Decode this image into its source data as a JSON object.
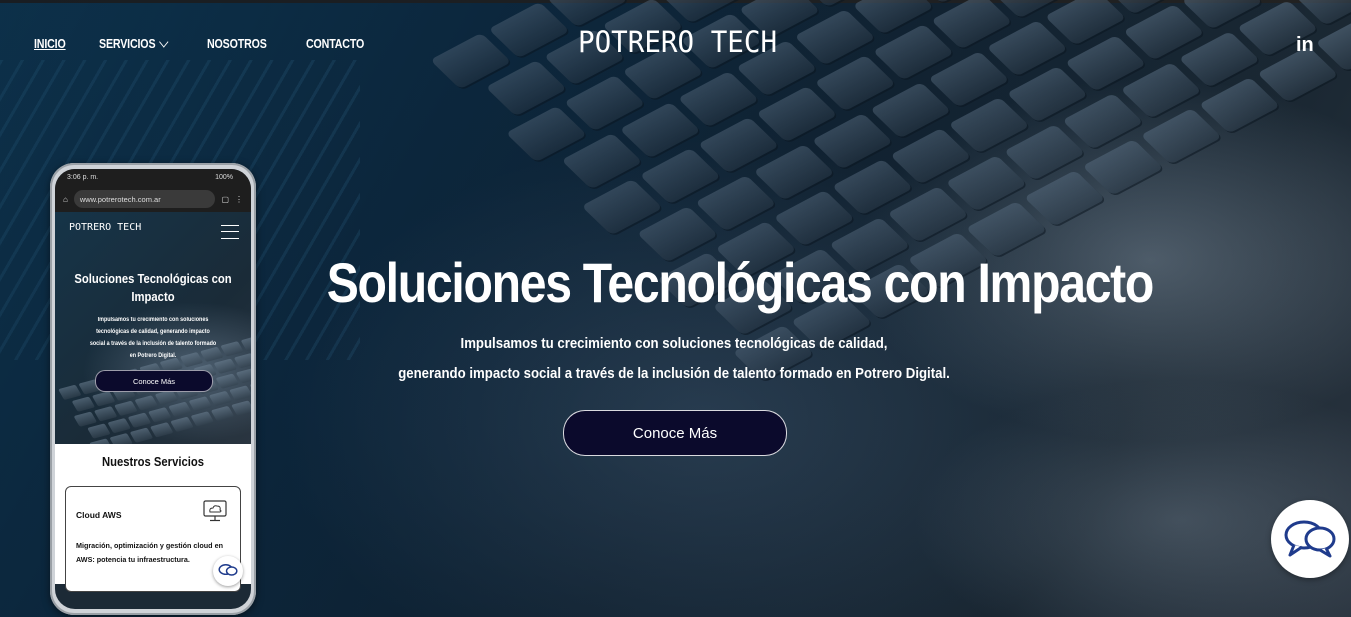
{
  "header": {
    "nav": [
      {
        "label": "INICIO",
        "active": true
      },
      {
        "label": "SERVICIOS",
        "has_dropdown": true
      },
      {
        "label": "NOSOTROS"
      },
      {
        "label": "CONTACTO"
      }
    ],
    "logo": "POTRERO TECH",
    "social": {
      "label": "in",
      "icon": "linkedin-icon"
    }
  },
  "hero": {
    "title": "Soluciones Tecnológicas con Impacto",
    "subtitle_line1": "Impulsamos tu crecimiento con soluciones tecnológicas de calidad,",
    "subtitle_line2": "generando impacto social a través de la inclusión de talento formado en Potrero Digital.",
    "cta_label": "Conoce Más"
  },
  "chat_widget": {
    "icon": "chat-bubbles-icon"
  },
  "phone_mockup": {
    "status_time": "3:06 p. m.",
    "status_battery": "100%",
    "url": "www.potrerotech.com.ar",
    "logo": "POTRERO TECH",
    "hero_title": "Soluciones Tecnológicas con Impacto",
    "hero_text": "Impulsamos tu crecimiento con soluciones tecnológicas de calidad, generando impacto social a través de la inclusión de talento formado en Potrero Digital.",
    "cta_label": "Conoce Más",
    "services_title": "Nuestros Servicios",
    "card": {
      "title": "Cloud AWS",
      "description": "Migración, optimización y gestión cloud en AWS: potencia tu  infraestructura.",
      "icon": "cloud-monitor-icon"
    }
  },
  "colors": {
    "cta_bg": "#0b0a2c",
    "hero_bg": "#0d2c44",
    "text": "#ffffff"
  }
}
